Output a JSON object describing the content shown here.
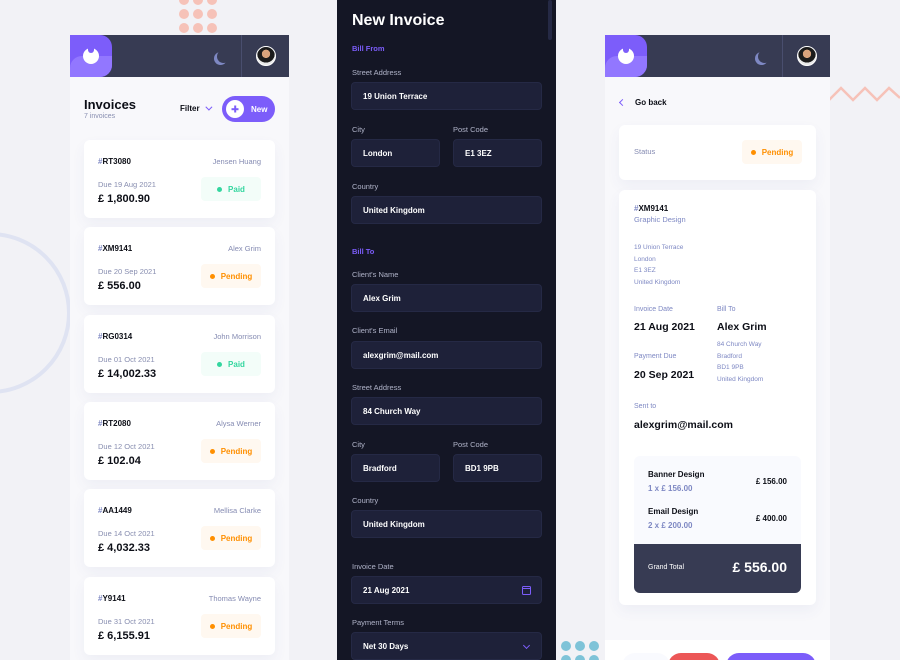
{
  "colors": {
    "accent": "#7c5dfa",
    "accent_light": "#9277ff",
    "dark_panel": "#141625",
    "field_dark": "#1e2139",
    "header": "#373b53",
    "paid": "#33d69f",
    "pending": "#ff8f00",
    "delete": "#ec5757"
  },
  "list_screen": {
    "title": "Invoices",
    "subtitle": "7 invoices",
    "filter_label": "Filter",
    "new_button_label": "New",
    "header_icons": [
      "logo-icon",
      "moon-icon",
      "avatar"
    ],
    "invoices": [
      {
        "id": "RT3080",
        "client": "Jensen Huang",
        "due": "Due 19 Aug 2021",
        "amount": "£ 1,800.90",
        "status": "Paid"
      },
      {
        "id": "XM9141",
        "client": "Alex Grim",
        "due": "Due 20 Sep 2021",
        "amount": "£ 556.00",
        "status": "Pending"
      },
      {
        "id": "RG0314",
        "client": "John Morrison",
        "due": "Due 01 Oct 2021",
        "amount": "£ 14,002.33",
        "status": "Paid"
      },
      {
        "id": "RT2080",
        "client": "Alysa Werner",
        "due": "Due 12 Oct 2021",
        "amount": "£ 102.04",
        "status": "Pending"
      },
      {
        "id": "AA1449",
        "client": "Mellisa Clarke",
        "due": "Due 14 Oct 2021",
        "amount": "£ 4,032.33",
        "status": "Pending"
      },
      {
        "id": "Y9141",
        "client": "Thomas Wayne",
        "due": "Due 31 Oct 2021",
        "amount": "£ 6,155.91",
        "status": "Pending"
      }
    ]
  },
  "form_screen": {
    "title": "New Invoice",
    "bill_from_heading": "Bill From",
    "bill_from": {
      "street_label": "Street Address",
      "street": "19 Union Terrace",
      "city_label": "City",
      "city": "London",
      "post_label": "Post Code",
      "post": "E1 3EZ",
      "country_label": "Country",
      "country": "United Kingdom"
    },
    "bill_to_heading": "Bill To",
    "bill_to": {
      "name_label": "Client's Name",
      "name": "Alex Grim",
      "email_label": "Client's Email",
      "email": "alexgrim@mail.com",
      "street_label": "Street Address",
      "street": "84 Church Way",
      "city_label": "City",
      "city": "Bradford",
      "post_label": "Post Code",
      "post": "BD1 9PB",
      "country_label": "Country",
      "country": "United Kingdom"
    },
    "invoice_date_label": "Invoice Date",
    "invoice_date": "21 Aug 2021",
    "payment_terms_label": "Payment Terms",
    "payment_terms": "Net 30 Days"
  },
  "detail_screen": {
    "back_label": "Go back",
    "status_label": "Status",
    "status": "Pending",
    "id": "XM9141",
    "description": "Graphic Design",
    "sender_address": [
      "19 Union Terrace",
      "London",
      "E1 3EZ",
      "United Kingdom"
    ],
    "invoice_date_label": "Invoice Date",
    "invoice_date": "21 Aug 2021",
    "payment_due_label": "Payment Due",
    "payment_due": "20 Sep 2021",
    "bill_to_label": "Bill To",
    "client_name": "Alex Grim",
    "client_address": [
      "84 Church Way",
      "Bradford",
      "BD1 9PB",
      "United Kingdom"
    ],
    "sent_to_label": "Sent to",
    "sent_to": "alexgrim@mail.com",
    "items": [
      {
        "name": "Banner Design",
        "qty": "1 x £ 156.00",
        "total": "£ 156.00"
      },
      {
        "name": "Email Design",
        "qty": "2 x £ 200.00",
        "total": "£ 400.00"
      }
    ],
    "grand_total_label": "Grand Total",
    "grand_total": "£ 556.00"
  }
}
